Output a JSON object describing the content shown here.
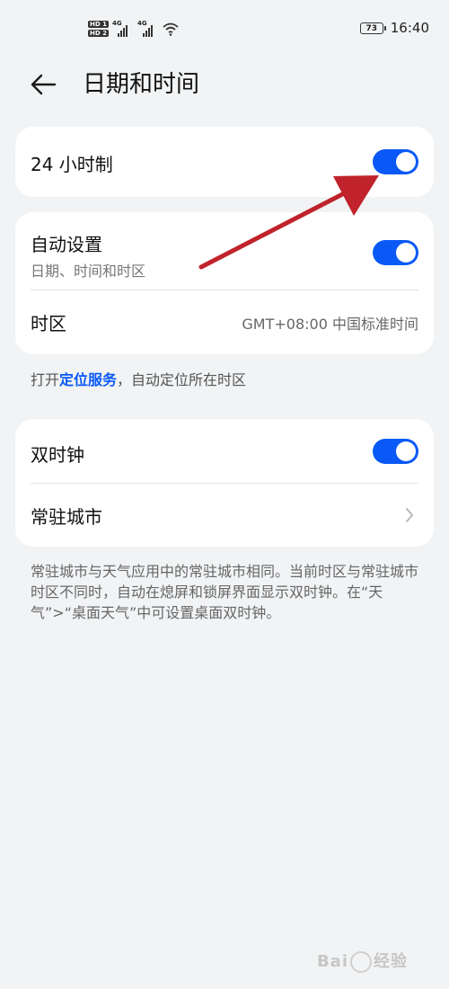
{
  "status_bar": {
    "sim1": "HD 1",
    "sim2": "HD 2",
    "network": "4G",
    "battery": "73",
    "time": "16:40"
  },
  "header": {
    "title": "日期和时间",
    "back_icon": "arrow-left-icon"
  },
  "card1": {
    "hour24_label": "24 小时制",
    "hour24_on": true
  },
  "card2": {
    "auto_label": "自动设置",
    "auto_sub": "日期、时间和时区",
    "auto_on": true,
    "timezone_label": "时区",
    "timezone_value": "GMT+08:00 中国标准时间"
  },
  "location_hint": {
    "prefix": "打开",
    "link": "定位服务",
    "suffix": "，自动定位所在时区"
  },
  "card3": {
    "dual_label": "双时钟",
    "dual_on": true,
    "home_city_label": "常驻城市"
  },
  "description": "常驻城市与天气应用中的常驻城市相同。当前时区与常驻城市时区不同时，自动在熄屏和锁屏界面显示双时钟。在“天气”>“桌面天气”中可设置桌面双时钟。",
  "annotation": {
    "arrow_color": "#c0232b"
  },
  "watermark": {
    "text_left": "Bai",
    "text_right": "经验"
  },
  "colors": {
    "accent": "#0a59f7",
    "background": "#f1f3f5"
  }
}
